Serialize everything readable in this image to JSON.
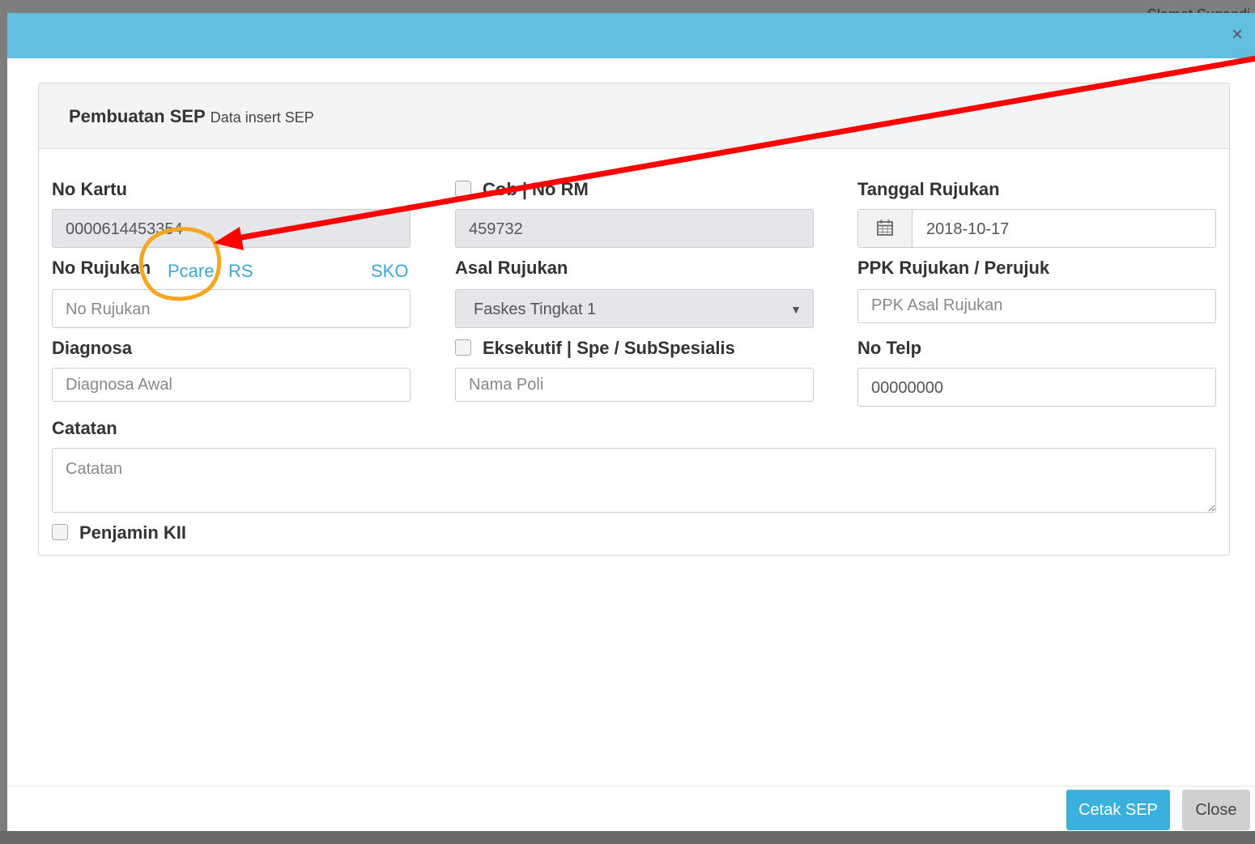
{
  "user": {
    "name": "Slamet Sugandi"
  },
  "modal": {
    "close_icon": "close-icon",
    "panel": {
      "title": "Pembuatan SEP",
      "subtitle": "Data insert SEP"
    },
    "fields": {
      "no_kartu": {
        "label": "No Kartu",
        "value": "0000614453354"
      },
      "cob": {
        "label": "Cob | No RM",
        "value": "459732"
      },
      "tanggal_rujukan": {
        "label": "Tanggal Rujukan",
        "value": "2018-10-17",
        "icon": "calendar-icon"
      },
      "no_rujukan": {
        "label": "No Rujukan",
        "placeholder": "No Rujukan",
        "link_pcare": "Pcare",
        "link_rs": "RS",
        "link_sko": "SKO"
      },
      "asal_rujukan": {
        "label": "Asal Rujukan",
        "selected": "Faskes Tingkat 1"
      },
      "ppk_rujukan": {
        "label": "PPK Rujukan / Perujuk",
        "placeholder": "PPK Asal Rujukan"
      },
      "diagnosa": {
        "label": "Diagnosa",
        "placeholder": "Diagnosa Awal"
      },
      "eksekutif": {
        "label": "Eksekutif | Spe / SubSpesialis",
        "placeholder": "Nama Poli"
      },
      "no_telp": {
        "label": "No Telp",
        "value": "00000000"
      },
      "catatan": {
        "label": "Catatan",
        "placeholder": "Catatan"
      },
      "penjamin": {
        "label": "Penjamin KII"
      }
    },
    "footer": {
      "cetak_label": "Cetak SEP",
      "close_label": "Close"
    }
  },
  "colors": {
    "header": "#62bfdf",
    "primary": "#3bb0dc",
    "link": "#3fa6d4",
    "annotation_arrow": "#ff0000",
    "annotation_circle": "#f5a623"
  }
}
